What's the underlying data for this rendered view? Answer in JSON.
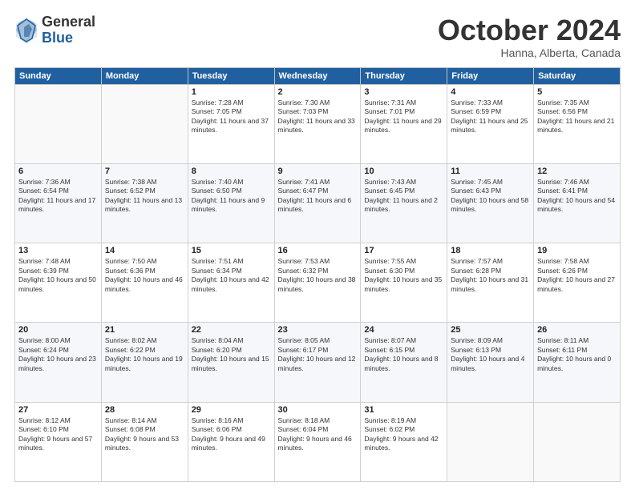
{
  "header": {
    "logo_general": "General",
    "logo_blue": "Blue",
    "month_title": "October 2024",
    "location": "Hanna, Alberta, Canada"
  },
  "weekdays": [
    "Sunday",
    "Monday",
    "Tuesday",
    "Wednesday",
    "Thursday",
    "Friday",
    "Saturday"
  ],
  "weeks": [
    [
      {
        "day": "",
        "info": ""
      },
      {
        "day": "",
        "info": ""
      },
      {
        "day": "1",
        "info": "Sunrise: 7:28 AM\nSunset: 7:05 PM\nDaylight: 11 hours and 37 minutes."
      },
      {
        "day": "2",
        "info": "Sunrise: 7:30 AM\nSunset: 7:03 PM\nDaylight: 11 hours and 33 minutes."
      },
      {
        "day": "3",
        "info": "Sunrise: 7:31 AM\nSunset: 7:01 PM\nDaylight: 11 hours and 29 minutes."
      },
      {
        "day": "4",
        "info": "Sunrise: 7:33 AM\nSunset: 6:59 PM\nDaylight: 11 hours and 25 minutes."
      },
      {
        "day": "5",
        "info": "Sunrise: 7:35 AM\nSunset: 6:56 PM\nDaylight: 11 hours and 21 minutes."
      }
    ],
    [
      {
        "day": "6",
        "info": "Sunrise: 7:36 AM\nSunset: 6:54 PM\nDaylight: 11 hours and 17 minutes."
      },
      {
        "day": "7",
        "info": "Sunrise: 7:38 AM\nSunset: 6:52 PM\nDaylight: 11 hours and 13 minutes."
      },
      {
        "day": "8",
        "info": "Sunrise: 7:40 AM\nSunset: 6:50 PM\nDaylight: 11 hours and 9 minutes."
      },
      {
        "day": "9",
        "info": "Sunrise: 7:41 AM\nSunset: 6:47 PM\nDaylight: 11 hours and 6 minutes."
      },
      {
        "day": "10",
        "info": "Sunrise: 7:43 AM\nSunset: 6:45 PM\nDaylight: 11 hours and 2 minutes."
      },
      {
        "day": "11",
        "info": "Sunrise: 7:45 AM\nSunset: 6:43 PM\nDaylight: 10 hours and 58 minutes."
      },
      {
        "day": "12",
        "info": "Sunrise: 7:46 AM\nSunset: 6:41 PM\nDaylight: 10 hours and 54 minutes."
      }
    ],
    [
      {
        "day": "13",
        "info": "Sunrise: 7:48 AM\nSunset: 6:39 PM\nDaylight: 10 hours and 50 minutes."
      },
      {
        "day": "14",
        "info": "Sunrise: 7:50 AM\nSunset: 6:36 PM\nDaylight: 10 hours and 46 minutes."
      },
      {
        "day": "15",
        "info": "Sunrise: 7:51 AM\nSunset: 6:34 PM\nDaylight: 10 hours and 42 minutes."
      },
      {
        "day": "16",
        "info": "Sunrise: 7:53 AM\nSunset: 6:32 PM\nDaylight: 10 hours and 38 minutes."
      },
      {
        "day": "17",
        "info": "Sunrise: 7:55 AM\nSunset: 6:30 PM\nDaylight: 10 hours and 35 minutes."
      },
      {
        "day": "18",
        "info": "Sunrise: 7:57 AM\nSunset: 6:28 PM\nDaylight: 10 hours and 31 minutes."
      },
      {
        "day": "19",
        "info": "Sunrise: 7:58 AM\nSunset: 6:26 PM\nDaylight: 10 hours and 27 minutes."
      }
    ],
    [
      {
        "day": "20",
        "info": "Sunrise: 8:00 AM\nSunset: 6:24 PM\nDaylight: 10 hours and 23 minutes."
      },
      {
        "day": "21",
        "info": "Sunrise: 8:02 AM\nSunset: 6:22 PM\nDaylight: 10 hours and 19 minutes."
      },
      {
        "day": "22",
        "info": "Sunrise: 8:04 AM\nSunset: 6:20 PM\nDaylight: 10 hours and 15 minutes."
      },
      {
        "day": "23",
        "info": "Sunrise: 8:05 AM\nSunset: 6:17 PM\nDaylight: 10 hours and 12 minutes."
      },
      {
        "day": "24",
        "info": "Sunrise: 8:07 AM\nSunset: 6:15 PM\nDaylight: 10 hours and 8 minutes."
      },
      {
        "day": "25",
        "info": "Sunrise: 8:09 AM\nSunset: 6:13 PM\nDaylight: 10 hours and 4 minutes."
      },
      {
        "day": "26",
        "info": "Sunrise: 8:11 AM\nSunset: 6:11 PM\nDaylight: 10 hours and 0 minutes."
      }
    ],
    [
      {
        "day": "27",
        "info": "Sunrise: 8:12 AM\nSunset: 6:10 PM\nDaylight: 9 hours and 57 minutes."
      },
      {
        "day": "28",
        "info": "Sunrise: 8:14 AM\nSunset: 6:08 PM\nDaylight: 9 hours and 53 minutes."
      },
      {
        "day": "29",
        "info": "Sunrise: 8:16 AM\nSunset: 6:06 PM\nDaylight: 9 hours and 49 minutes."
      },
      {
        "day": "30",
        "info": "Sunrise: 8:18 AM\nSunset: 6:04 PM\nDaylight: 9 hours and 46 minutes."
      },
      {
        "day": "31",
        "info": "Sunrise: 8:19 AM\nSunset: 6:02 PM\nDaylight: 9 hours and 42 minutes."
      },
      {
        "day": "",
        "info": ""
      },
      {
        "day": "",
        "info": ""
      }
    ]
  ]
}
